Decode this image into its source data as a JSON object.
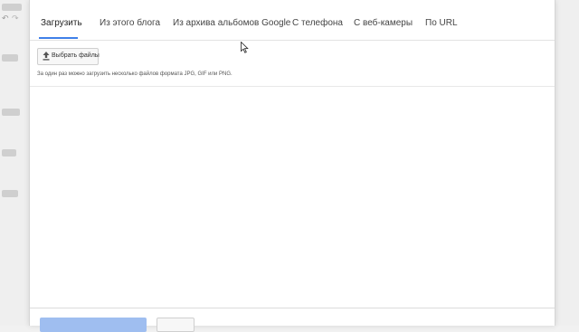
{
  "tabs": [
    {
      "label": "Загрузить",
      "active": true
    },
    {
      "label": "Из этого блога",
      "active": false
    },
    {
      "label": "Из архива альбомов Google",
      "active": false
    },
    {
      "label": "С телефона",
      "active": false
    },
    {
      "label": "С веб-камеры",
      "active": false
    },
    {
      "label": "По URL",
      "active": false
    }
  ],
  "upload": {
    "button_label": "Выбрать файлы",
    "icon": "upload-icon",
    "hint": "За один раз можно загрузить несколько файлов формата JPG, GIF или PNG."
  },
  "colors": {
    "accent": "#3f80e8",
    "primary_button_disabled": "#9fbef0"
  }
}
